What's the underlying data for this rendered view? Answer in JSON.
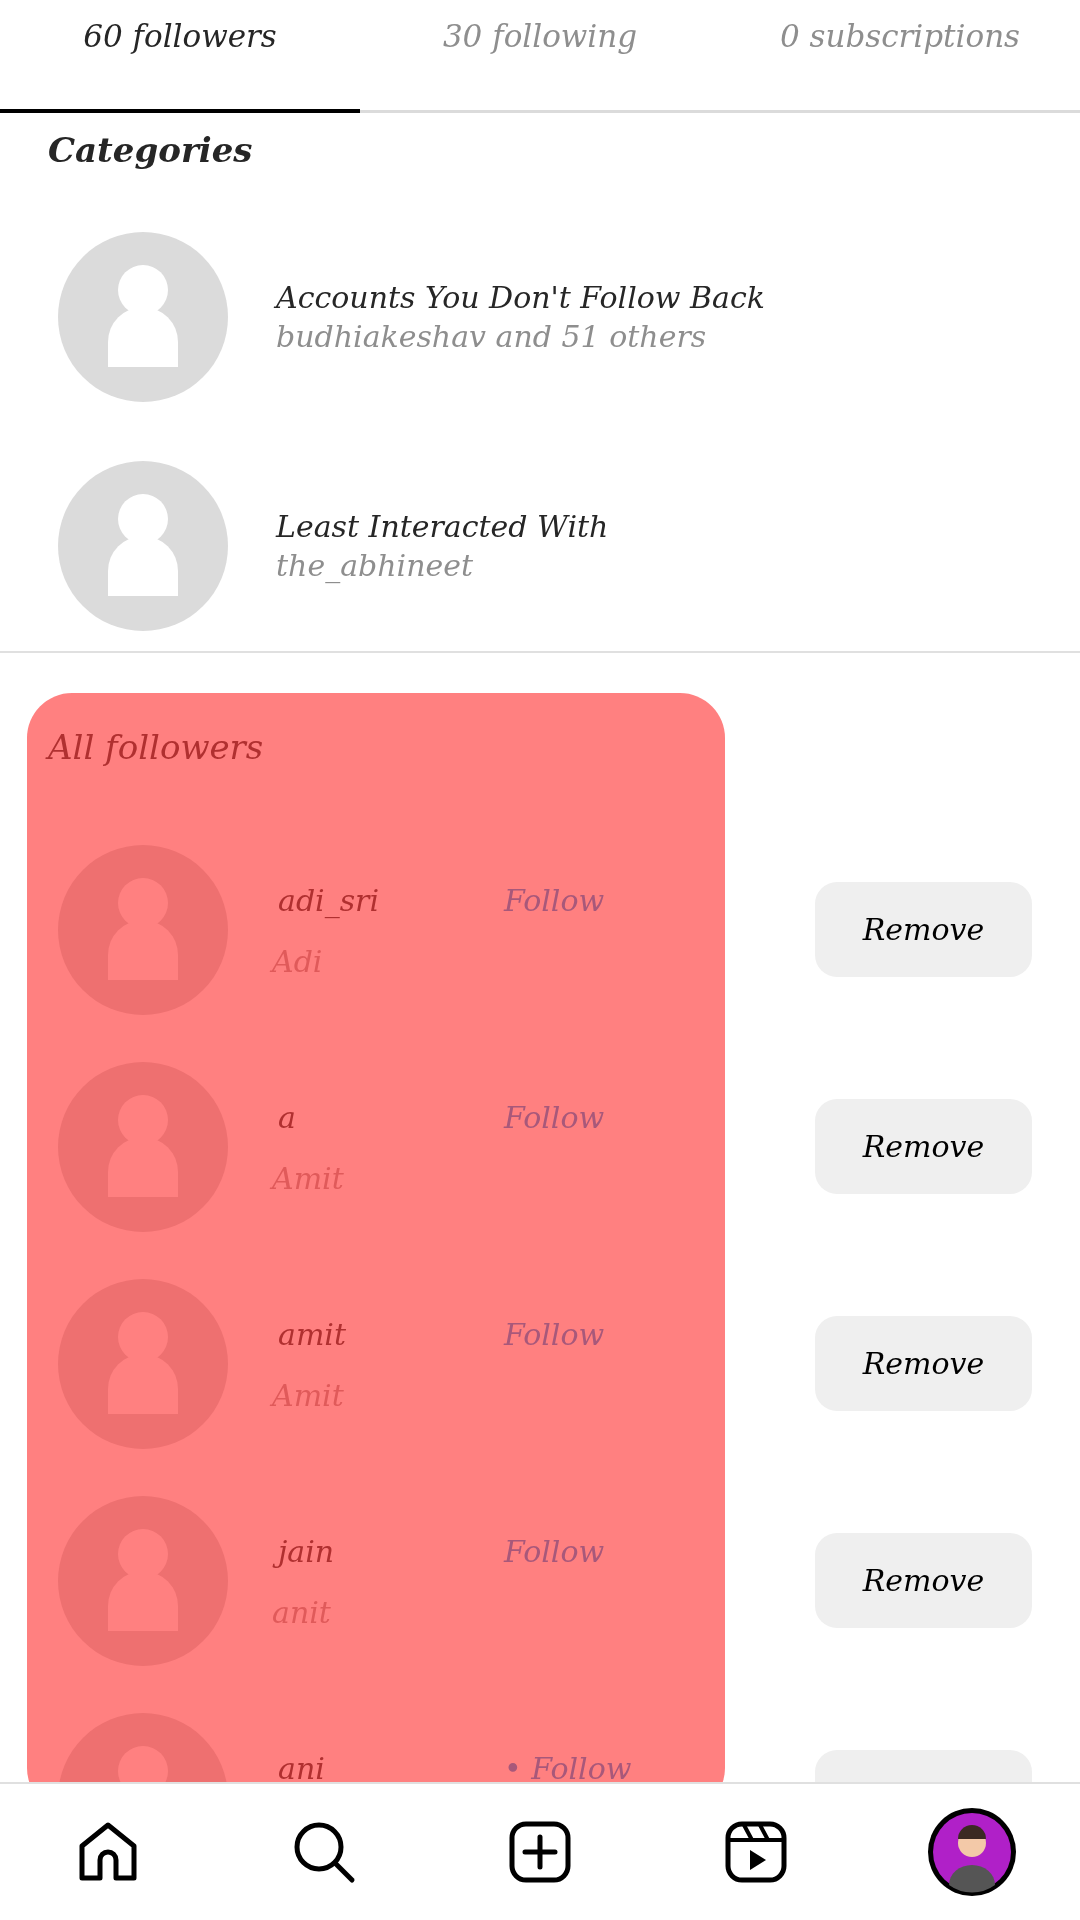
{
  "tabs": [
    {
      "label": "60 followers",
      "selected": true
    },
    {
      "label": "30 following",
      "selected": false
    },
    {
      "label": "0 subscriptions",
      "selected": false
    }
  ],
  "categories": {
    "heading": "Categories",
    "items": [
      {
        "title": "Accounts You Don't Follow Back",
        "subtitle": "budhiakeshav and 51 others"
      },
      {
        "title": "Least Interacted With",
        "subtitle": "the_abhineet"
      }
    ]
  },
  "followers": {
    "heading": "All followers",
    "redacted": true,
    "rows": [
      {
        "username": "adi_sri",
        "follow": "Follow",
        "name": "Adi",
        "button": "Remove"
      },
      {
        "username": "a",
        "follow": "Follow",
        "name": "Amit",
        "button": "Remove"
      },
      {
        "username": "amit",
        "follow": "Follow",
        "name": "Amit",
        "button": "Remove"
      },
      {
        "username": "jain",
        "follow": "Follow",
        "name": "anit",
        "button": "Remove"
      },
      {
        "username": "ani",
        "follow": "• Follow"
      }
    ]
  },
  "nav": [
    {
      "kind": "home",
      "selected": false
    },
    {
      "kind": "search",
      "selected": false
    },
    {
      "kind": "create",
      "selected": false
    },
    {
      "kind": "reels",
      "selected": false
    },
    {
      "kind": "profile",
      "selected": true
    }
  ]
}
